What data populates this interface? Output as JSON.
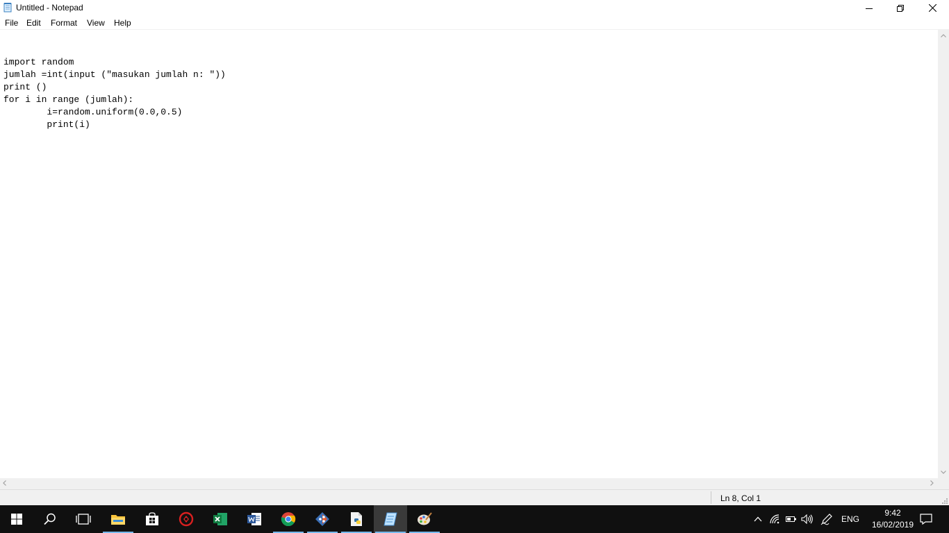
{
  "window": {
    "title": "Untitled - Notepad",
    "icons": {
      "app": "notepad-icon",
      "minimize": "minimize-icon",
      "maximize": "restore-icon",
      "close": "close-icon"
    }
  },
  "menu": [
    "File",
    "Edit",
    "Format",
    "View",
    "Help"
  ],
  "editor": {
    "lines": [
      "",
      "import random",
      "jumlah =int(input (\"masukan jumlah n: \"))",
      "print ()",
      "for i in range (jumlah):",
      "\ti=random.uniform(0.0,0.5)",
      "\tprint(i)"
    ]
  },
  "status": {
    "position": "Ln 8, Col 1"
  },
  "taskbar": {
    "apps": [
      "start-icon",
      "search-icon",
      "task-view-icon",
      "file-explorer-icon",
      "store-icon",
      "red-app-icon",
      "excel-icon",
      "word-icon",
      "chrome-icon",
      "git-icon",
      "python-idle-icon",
      "notepad-icon",
      "paint-icon"
    ],
    "tray": {
      "language": "ENG",
      "time": "9:42",
      "date": "16/02/2019",
      "icons": [
        "chevron-up-icon",
        "wifi-icon",
        "battery-icon",
        "volume-icon",
        "pen-icon",
        "notification-icon"
      ]
    }
  },
  "colors": {
    "taskbar": "#101010",
    "accent": "#76b9ed",
    "status_bar": "#f0f0f0"
  }
}
